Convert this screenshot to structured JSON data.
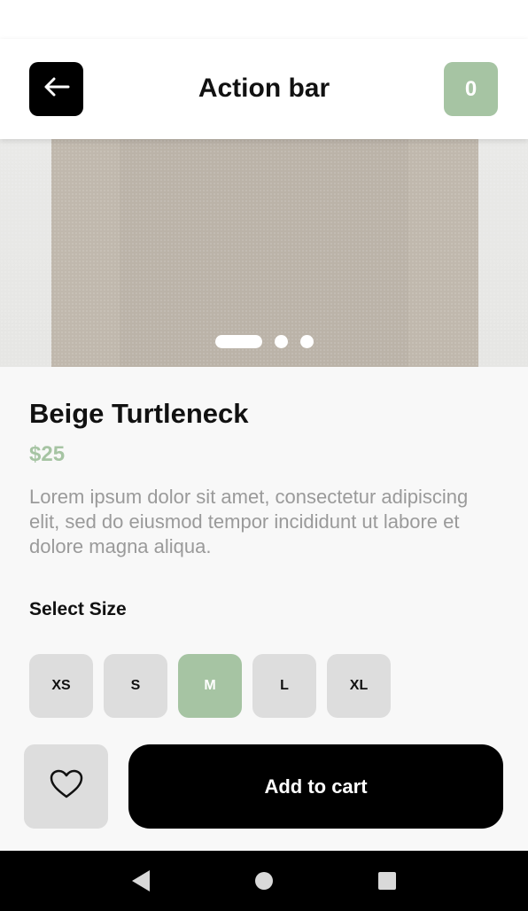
{
  "action_bar": {
    "title": "Action bar",
    "cart_count": "0"
  },
  "gallery": {
    "image": "beige-turtleneck-photo",
    "dots": 3,
    "active_dot": 0
  },
  "product": {
    "name": "Beige Turtleneck",
    "price": "$25",
    "description": "Lorem ipsum dolor sit amet, consectetur adipiscing elit, sed do eiusmod tempor incididunt ut labore et dolore magna aliqua."
  },
  "size": {
    "label": "Select Size",
    "options": [
      "XS",
      "S",
      "M",
      "L",
      "XL"
    ],
    "selected": "M"
  },
  "actions": {
    "add_to_cart_label": "Add to cart"
  },
  "colors": {
    "accent": "#a6c4a3",
    "primary": "#000000",
    "chip": "#dddddd"
  },
  "icons": {
    "back": "arrow-left-icon",
    "favorite": "heart-outline-icon",
    "nav_back": "triangle-back-icon",
    "nav_home": "circle-home-icon",
    "nav_recent": "square-recents-icon"
  }
}
